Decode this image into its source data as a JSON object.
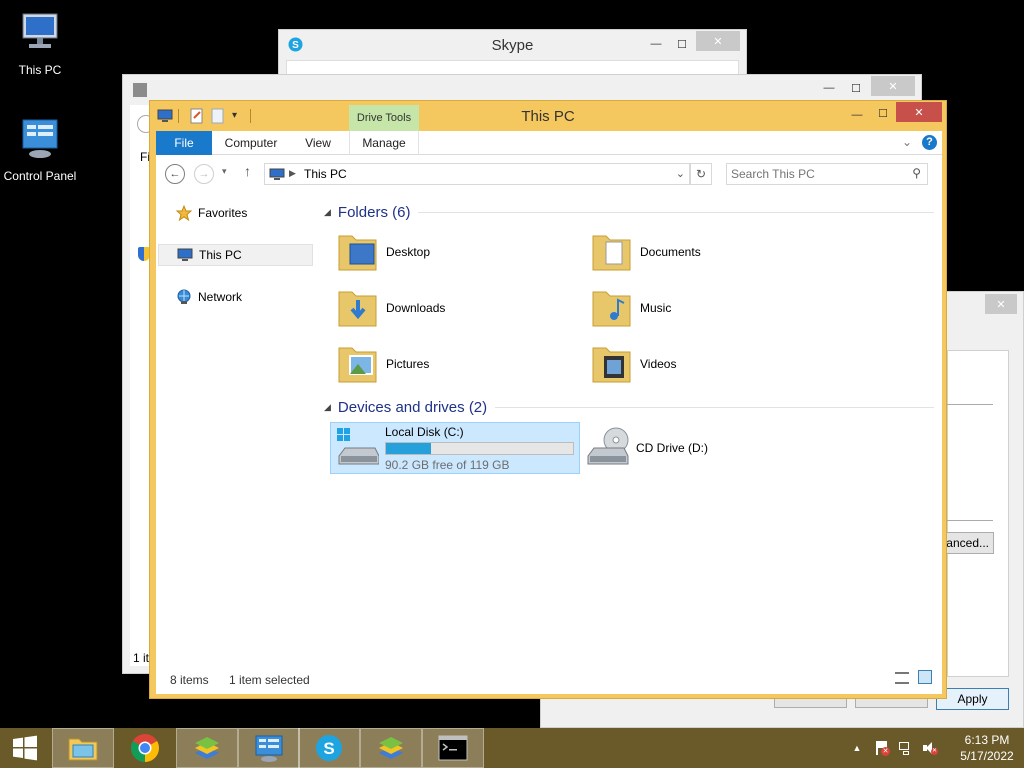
{
  "desktop": {
    "icons": [
      {
        "label": "This PC"
      },
      {
        "label": "Control Panel"
      }
    ]
  },
  "skype_window": {
    "title": "Skype"
  },
  "bg_window": {
    "left_text_1": "Fi",
    "left_text_2": "1 it"
  },
  "right_window": {
    "advanced_label": "anced...",
    "apply_label": "Apply"
  },
  "explorer": {
    "title": "This PC",
    "context_tab": "Drive Tools",
    "tabs": [
      "File",
      "Computer",
      "View",
      "Manage"
    ],
    "address": {
      "path": "This PC",
      "search_placeholder": "Search This PC"
    },
    "nav": [
      {
        "label": "Favorites",
        "icon": "star-icon"
      },
      {
        "label": "This PC",
        "icon": "computer-icon",
        "selected": true
      },
      {
        "label": "Network",
        "icon": "network-icon"
      }
    ],
    "folders_header": "Folders (6)",
    "folders": [
      {
        "label": "Desktop"
      },
      {
        "label": "Documents"
      },
      {
        "label": "Downloads"
      },
      {
        "label": "Music"
      },
      {
        "label": "Pictures"
      },
      {
        "label": "Videos"
      }
    ],
    "devices_header": "Devices and drives (2)",
    "drives": [
      {
        "label": "Local Disk (C:)",
        "detail": "90.2 GB free of 119 GB",
        "used_fraction": 0.24,
        "selected": true
      },
      {
        "label": "CD Drive (D:)"
      }
    ],
    "status": {
      "items": "8 items",
      "selected": "1 item selected"
    }
  },
  "taskbar": {
    "clock_time": "6:13 PM",
    "clock_date": "5/17/2022"
  },
  "colors": {
    "accent_blue": "#1979ca",
    "explorer_frame": "#f5c75f",
    "close_red": "#c7504a",
    "context_tab_green": "#c6e6a9",
    "taskbar": "#6b5a29"
  }
}
